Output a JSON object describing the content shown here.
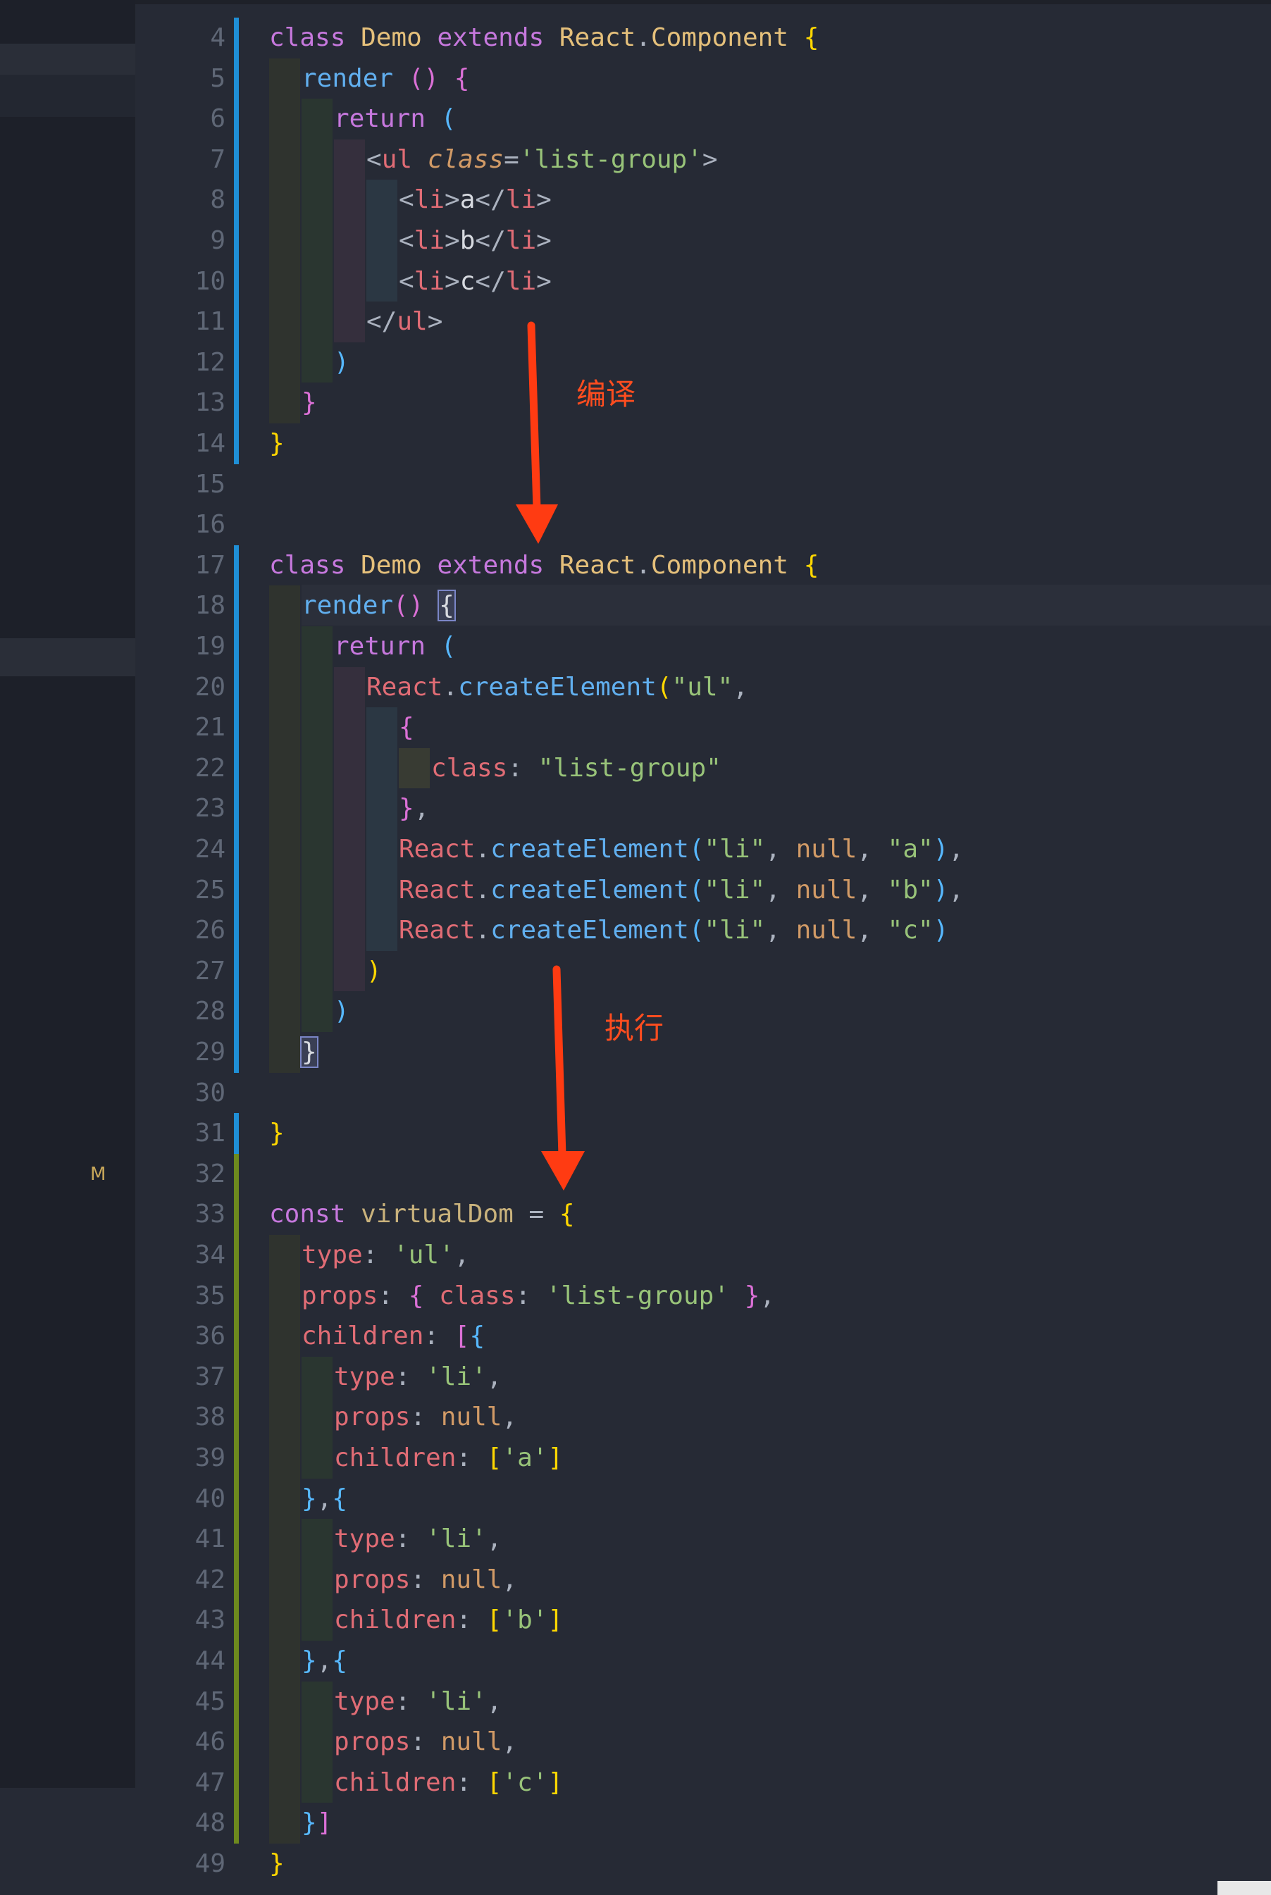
{
  "sidebar": {
    "badge": "M"
  },
  "editor": {
    "lines": [
      {
        "n": 4,
        "indent": 0,
        "tokens": [
          [
            "k",
            "class"
          ],
          [
            "w",
            " "
          ],
          [
            "cls",
            "Demo"
          ],
          [
            "w",
            " "
          ],
          [
            "k",
            "extends"
          ],
          [
            "w",
            " "
          ],
          [
            "cls",
            "React"
          ],
          [
            "p",
            "."
          ],
          [
            "cls",
            "Component"
          ],
          [
            "w",
            " "
          ],
          [
            "y",
            "{"
          ]
        ]
      },
      {
        "n": 5,
        "indent": 1,
        "tokens": [
          [
            "f",
            "render"
          ],
          [
            "w",
            " "
          ],
          [
            "m",
            "()"
          ],
          [
            "w",
            " "
          ],
          [
            "m",
            "{"
          ]
        ]
      },
      {
        "n": 6,
        "indent": 2,
        "tokens": [
          [
            "k",
            "return"
          ],
          [
            "w",
            " "
          ],
          [
            "b",
            "("
          ]
        ]
      },
      {
        "n": 7,
        "indent": 3,
        "tokens": [
          [
            "p",
            "<"
          ],
          [
            "t",
            "ul"
          ],
          [
            "w",
            " "
          ],
          [
            "it",
            "class"
          ],
          [
            "p",
            "="
          ],
          [
            "s",
            "'list-group'"
          ],
          [
            "p",
            ">"
          ]
        ]
      },
      {
        "n": 8,
        "indent": 4,
        "tokens": [
          [
            "p",
            "<"
          ],
          [
            "t",
            "li"
          ],
          [
            "p",
            ">"
          ],
          [
            "w",
            "a"
          ],
          [
            "p",
            "</"
          ],
          [
            "t",
            "li"
          ],
          [
            "p",
            ">"
          ]
        ]
      },
      {
        "n": 9,
        "indent": 4,
        "tokens": [
          [
            "p",
            "<"
          ],
          [
            "t",
            "li"
          ],
          [
            "p",
            ">"
          ],
          [
            "w",
            "b"
          ],
          [
            "p",
            "</"
          ],
          [
            "t",
            "li"
          ],
          [
            "p",
            ">"
          ]
        ]
      },
      {
        "n": 10,
        "indent": 4,
        "tokens": [
          [
            "p",
            "<"
          ],
          [
            "t",
            "li"
          ],
          [
            "p",
            ">"
          ],
          [
            "w",
            "c"
          ],
          [
            "p",
            "</"
          ],
          [
            "t",
            "li"
          ],
          [
            "p",
            ">"
          ]
        ]
      },
      {
        "n": 11,
        "indent": 3,
        "tokens": [
          [
            "p",
            "</"
          ],
          [
            "t",
            "ul"
          ],
          [
            "p",
            ">"
          ]
        ]
      },
      {
        "n": 12,
        "indent": 2,
        "tokens": [
          [
            "b",
            ")"
          ]
        ]
      },
      {
        "n": 13,
        "indent": 1,
        "tokens": [
          [
            "m",
            "}"
          ]
        ]
      },
      {
        "n": 14,
        "indent": 0,
        "tokens": [
          [
            "y",
            "}"
          ]
        ]
      },
      {
        "n": 15,
        "indent": 0,
        "tokens": []
      },
      {
        "n": 16,
        "indent": 0,
        "tokens": []
      },
      {
        "n": 17,
        "indent": 0,
        "tokens": [
          [
            "k",
            "class"
          ],
          [
            "w",
            " "
          ],
          [
            "cls",
            "Demo"
          ],
          [
            "w",
            " "
          ],
          [
            "k",
            "extends"
          ],
          [
            "w",
            " "
          ],
          [
            "cls",
            "React"
          ],
          [
            "p",
            "."
          ],
          [
            "cls",
            "Component"
          ],
          [
            "w",
            " "
          ],
          [
            "y",
            "{"
          ]
        ]
      },
      {
        "n": 18,
        "indent": 1,
        "tokens": [
          [
            "f",
            "render"
          ],
          [
            "m",
            "()"
          ],
          [
            "w",
            " "
          ],
          [
            "bm",
            "{"
          ]
        ]
      },
      {
        "n": 19,
        "indent": 2,
        "tokens": [
          [
            "k",
            "return"
          ],
          [
            "w",
            " "
          ],
          [
            "b",
            "("
          ]
        ]
      },
      {
        "n": 20,
        "indent": 3,
        "tokens": [
          [
            "t",
            "React"
          ],
          [
            "p",
            "."
          ],
          [
            "f",
            "createElement"
          ],
          [
            "y",
            "("
          ],
          [
            "s",
            "\"ul\""
          ],
          [
            "p",
            ","
          ]
        ]
      },
      {
        "n": 21,
        "indent": 4,
        "tokens": [
          [
            "m",
            "{"
          ]
        ]
      },
      {
        "n": 22,
        "indent": 5,
        "tokens": [
          [
            "t",
            "class"
          ],
          [
            "p",
            ":"
          ],
          [
            "w",
            " "
          ],
          [
            "s",
            "\"list-group\""
          ]
        ]
      },
      {
        "n": 23,
        "indent": 4,
        "tokens": [
          [
            "m",
            "}"
          ],
          [
            "p",
            ","
          ]
        ]
      },
      {
        "n": 24,
        "indent": 4,
        "tokens": [
          [
            "t",
            "React"
          ],
          [
            "p",
            "."
          ],
          [
            "f",
            "createElement"
          ],
          [
            "b",
            "("
          ],
          [
            "s",
            "\"li\""
          ],
          [
            "p",
            ","
          ],
          [
            "w",
            " "
          ],
          [
            "n",
            "null"
          ],
          [
            "p",
            ","
          ],
          [
            "w",
            " "
          ],
          [
            "s",
            "\"a\""
          ],
          [
            "b",
            ")"
          ],
          [
            "p",
            ","
          ]
        ]
      },
      {
        "n": 25,
        "indent": 4,
        "tokens": [
          [
            "t",
            "React"
          ],
          [
            "p",
            "."
          ],
          [
            "f",
            "createElement"
          ],
          [
            "b",
            "("
          ],
          [
            "s",
            "\"li\""
          ],
          [
            "p",
            ","
          ],
          [
            "w",
            " "
          ],
          [
            "n",
            "null"
          ],
          [
            "p",
            ","
          ],
          [
            "w",
            " "
          ],
          [
            "s",
            "\"b\""
          ],
          [
            "b",
            ")"
          ],
          [
            "p",
            ","
          ]
        ]
      },
      {
        "n": 26,
        "indent": 4,
        "tokens": [
          [
            "t",
            "React"
          ],
          [
            "p",
            "."
          ],
          [
            "f",
            "createElement"
          ],
          [
            "b",
            "("
          ],
          [
            "s",
            "\"li\""
          ],
          [
            "p",
            ","
          ],
          [
            "w",
            " "
          ],
          [
            "n",
            "null"
          ],
          [
            "p",
            ","
          ],
          [
            "w",
            " "
          ],
          [
            "s",
            "\"c\""
          ],
          [
            "b",
            ")"
          ]
        ]
      },
      {
        "n": 27,
        "indent": 3,
        "tokens": [
          [
            "y",
            ")"
          ]
        ]
      },
      {
        "n": 28,
        "indent": 2,
        "tokens": [
          [
            "b",
            ")"
          ]
        ]
      },
      {
        "n": 29,
        "indent": 1,
        "tokens": [
          [
            "bm",
            "}"
          ]
        ]
      },
      {
        "n": 30,
        "indent": 0,
        "tokens": []
      },
      {
        "n": 31,
        "indent": 0,
        "tokens": [
          [
            "y",
            "}"
          ]
        ]
      },
      {
        "n": 32,
        "indent": 0,
        "tokens": []
      },
      {
        "n": 33,
        "indent": 0,
        "tokens": [
          [
            "k",
            "const"
          ],
          [
            "w",
            " "
          ],
          [
            "cd",
            "virtualDom"
          ],
          [
            "w",
            " "
          ],
          [
            "p",
            "="
          ],
          [
            "w",
            " "
          ],
          [
            "y",
            "{"
          ]
        ]
      },
      {
        "n": 34,
        "indent": 1,
        "tokens": [
          [
            "t",
            "type"
          ],
          [
            "p",
            ":"
          ],
          [
            "w",
            " "
          ],
          [
            "s",
            "'ul'"
          ],
          [
            "p",
            ","
          ]
        ]
      },
      {
        "n": 35,
        "indent": 1,
        "tokens": [
          [
            "t",
            "props"
          ],
          [
            "p",
            ":"
          ],
          [
            "w",
            " "
          ],
          [
            "m",
            "{"
          ],
          [
            "w",
            " "
          ],
          [
            "t",
            "class"
          ],
          [
            "p",
            ":"
          ],
          [
            "w",
            " "
          ],
          [
            "s",
            "'list-group'"
          ],
          [
            "w",
            " "
          ],
          [
            "m",
            "}"
          ],
          [
            "p",
            ","
          ]
        ]
      },
      {
        "n": 36,
        "indent": 1,
        "tokens": [
          [
            "t",
            "children"
          ],
          [
            "p",
            ":"
          ],
          [
            "w",
            " "
          ],
          [
            "m",
            "["
          ],
          [
            "b",
            "{"
          ]
        ]
      },
      {
        "n": 37,
        "indent": 2,
        "tokens": [
          [
            "t",
            "type"
          ],
          [
            "p",
            ":"
          ],
          [
            "w",
            " "
          ],
          [
            "s",
            "'li'"
          ],
          [
            "p",
            ","
          ]
        ]
      },
      {
        "n": 38,
        "indent": 2,
        "tokens": [
          [
            "t",
            "props"
          ],
          [
            "p",
            ":"
          ],
          [
            "w",
            " "
          ],
          [
            "n",
            "null"
          ],
          [
            "p",
            ","
          ]
        ]
      },
      {
        "n": 39,
        "indent": 2,
        "tokens": [
          [
            "t",
            "children"
          ],
          [
            "p",
            ":"
          ],
          [
            "w",
            " "
          ],
          [
            "y",
            "["
          ],
          [
            "s",
            "'a'"
          ],
          [
            "y",
            "]"
          ]
        ]
      },
      {
        "n": 40,
        "indent": 1,
        "tokens": [
          [
            "b",
            "}"
          ],
          [
            "p",
            ","
          ],
          [
            "b",
            "{"
          ]
        ]
      },
      {
        "n": 41,
        "indent": 2,
        "tokens": [
          [
            "t",
            "type"
          ],
          [
            "p",
            ":"
          ],
          [
            "w",
            " "
          ],
          [
            "s",
            "'li'"
          ],
          [
            "p",
            ","
          ]
        ]
      },
      {
        "n": 42,
        "indent": 2,
        "tokens": [
          [
            "t",
            "props"
          ],
          [
            "p",
            ":"
          ],
          [
            "w",
            " "
          ],
          [
            "n",
            "null"
          ],
          [
            "p",
            ","
          ]
        ]
      },
      {
        "n": 43,
        "indent": 2,
        "tokens": [
          [
            "t",
            "children"
          ],
          [
            "p",
            ":"
          ],
          [
            "w",
            " "
          ],
          [
            "y",
            "["
          ],
          [
            "s",
            "'b'"
          ],
          [
            "y",
            "]"
          ]
        ]
      },
      {
        "n": 44,
        "indent": 1,
        "tokens": [
          [
            "b",
            "}"
          ],
          [
            "p",
            ","
          ],
          [
            "b",
            "{"
          ]
        ]
      },
      {
        "n": 45,
        "indent": 2,
        "tokens": [
          [
            "t",
            "type"
          ],
          [
            "p",
            ":"
          ],
          [
            "w",
            " "
          ],
          [
            "s",
            "'li'"
          ],
          [
            "p",
            ","
          ]
        ]
      },
      {
        "n": 46,
        "indent": 2,
        "tokens": [
          [
            "t",
            "props"
          ],
          [
            "p",
            ":"
          ],
          [
            "w",
            " "
          ],
          [
            "n",
            "null"
          ],
          [
            "p",
            ","
          ]
        ]
      },
      {
        "n": 47,
        "indent": 2,
        "tokens": [
          [
            "t",
            "children"
          ],
          [
            "p",
            ":"
          ],
          [
            "w",
            " "
          ],
          [
            "y",
            "["
          ],
          [
            "s",
            "'c'"
          ],
          [
            "y",
            "]"
          ]
        ]
      },
      {
        "n": 48,
        "indent": 1,
        "tokens": [
          [
            "b",
            "}"
          ],
          [
            "m",
            "]"
          ]
        ]
      },
      {
        "n": 49,
        "indent": 0,
        "tokens": [
          [
            "y",
            "}"
          ]
        ]
      }
    ]
  },
  "annotations": {
    "compile": "编译",
    "execute": "执行"
  },
  "colors": {
    "git_modified": "#1f8fd6",
    "git_added": "#6e8a1e",
    "arrow": "#ff3b12"
  }
}
